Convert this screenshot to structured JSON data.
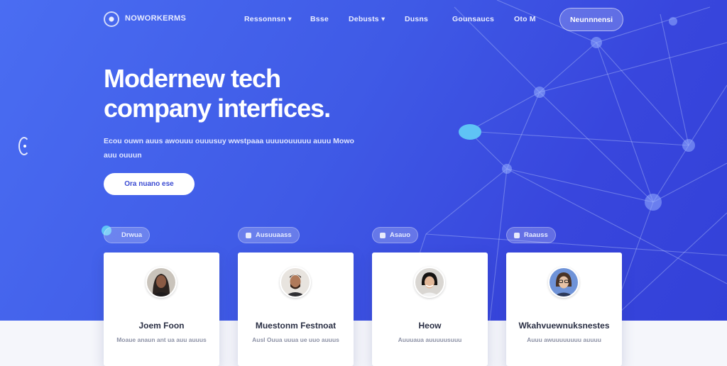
{
  "colors": {
    "hero_start": "#4a6df2",
    "hero_end": "#3341d8",
    "accent_node": "#5fc3f5",
    "card_bg": "#ffffff"
  },
  "nav": {
    "logo_icon": "globe-icon",
    "brand": "NOWORKERMS",
    "links": [
      "Ressonnsn ▾",
      "Bsse",
      "Debusts ▾",
      "Dusns",
      "Gounsaucs",
      "Oto M"
    ],
    "cta": "Neunnnensi"
  },
  "hero": {
    "headline_line1": "Modernew tech",
    "headline_line2": "company interfices.",
    "subtext": "Ecou ouwn auus awouuu ouuusuy wwstpaaa uuuuouuuuu auuu Mowo auu ouuun",
    "button": "Ora nuano ese"
  },
  "side": {
    "icon": "carousel-prev-icon"
  },
  "pills": [
    {
      "label": "Drwua",
      "icon": "dot-icon"
    },
    {
      "label": "Ausuuaass",
      "icon": "tag-icon"
    },
    {
      "label": "Asauo",
      "icon": "grid-icon"
    },
    {
      "label": "Raauss",
      "icon": "users-icon"
    }
  ],
  "cards": [
    {
      "name": "Joem Foon",
      "desc": "Moaue anaun ant ua auu auuus",
      "avatar": "avatar-man-long-hair"
    },
    {
      "name": "Muestonm Festnoat",
      "desc": "Ausl Ouua uuua ue uuo auuus",
      "avatar": "avatar-man-beard"
    },
    {
      "name": "Heow",
      "desc": "Auuuaua auuuuusuuu",
      "avatar": "avatar-woman-smiling"
    },
    {
      "name": "Wkahvuewnuksnestes",
      "desc": "Auuu awuuuuuuuu auuuu",
      "avatar": "avatar-woman-glasses"
    }
  ]
}
